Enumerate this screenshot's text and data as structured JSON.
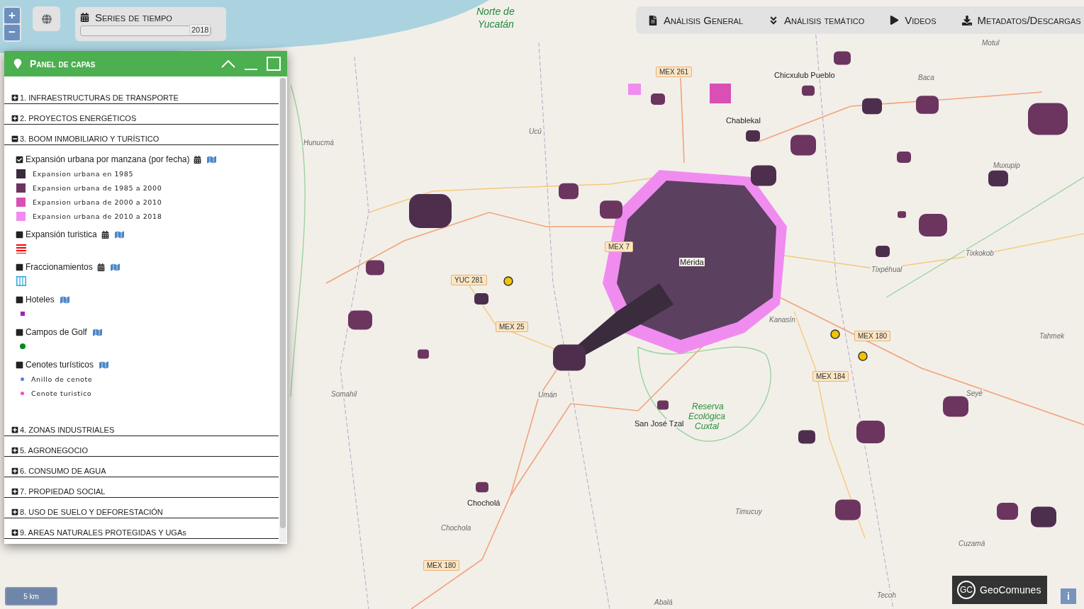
{
  "zoom": {
    "in": "+",
    "out": "−"
  },
  "time_series": {
    "title": "Series de tiempo",
    "reading": "2018",
    "level": 1
  },
  "nav": [
    {
      "label": "Análisis General",
      "kind": "file"
    },
    {
      "label": "Análisis temático",
      "kind": "double-down"
    },
    {
      "label": "Videos",
      "kind": "play"
    },
    {
      "label": "Metadatos/Descargas",
      "kind": "download"
    }
  ],
  "panel": {
    "title": "Panel de capas",
    "sections": [
      {
        "label": "1. INFRAESTRUCTURAS DE TRANSPORTE",
        "expanded": false
      },
      {
        "label": "2. PROYECTOS ENERGÉTICOS",
        "expanded": false
      },
      {
        "label": "3. BOOM INMOBILIARIO Y TURÍSTICO",
        "expanded": true,
        "layers": [
          {
            "label": "Expansión urbana por manzana (por fecha)",
            "checked": true,
            "calendar": true,
            "legend": [
              {
                "kind": "swatch",
                "color": "#3a2b3d",
                "label": "Expansion urbana en 1985"
              },
              {
                "kind": "swatch",
                "color": "#6b3560",
                "label": "Expansion urbana de 1985 a 2000"
              },
              {
                "kind": "swatch",
                "color": "#d94fb5",
                "label": "Expansion urbana de 2000 a 2010"
              },
              {
                "kind": "swatch",
                "color": "#f08cf0",
                "label": "Expansion urbana de 2010 a 2018"
              }
            ]
          },
          {
            "label": "Expansión turistica",
            "checked": false,
            "calendar": true,
            "legend": [
              {
                "kind": "hatch",
                "color": "#ff0000"
              }
            ]
          },
          {
            "label": "Fraccionamientos",
            "checked": false,
            "calendar": true,
            "legend": [
              {
                "kind": "grid",
                "color": "#29a9e0"
              }
            ]
          },
          {
            "label": "Hoteles",
            "checked": false,
            "calendar": false,
            "legend": [
              {
                "kind": "square",
                "color": "#a020c0"
              }
            ]
          },
          {
            "label": "Campos de Golf",
            "checked": false,
            "calendar": false,
            "legend": [
              {
                "kind": "dot",
                "color": "#008a20"
              }
            ]
          },
          {
            "label": "Cenotes turísticos",
            "checked": false,
            "calendar": false,
            "legend": [
              {
                "kind": "small-dot",
                "color": "#4a86e8",
                "label": "Anillo de cenote"
              },
              {
                "kind": "small-dot",
                "color": "#ff44cc",
                "label": "Cenote turistico"
              }
            ]
          }
        ]
      },
      {
        "label": "4. ZONAS INDUSTRIALES",
        "expanded": false
      },
      {
        "label": "5. AGRONEGOCIO",
        "expanded": false
      },
      {
        "label": "6. CONSUMO DE AGUA",
        "expanded": false
      },
      {
        "label": "7. PROPIEDAD SOCIAL",
        "expanded": false
      },
      {
        "label": "8. USO DE SUELO Y DEFORESTACIÓN",
        "expanded": false
      },
      {
        "label": "9. AREAS NATURALES PROTEGIDAS Y UGAs",
        "expanded": false
      }
    ]
  },
  "map": {
    "labels": [
      {
        "text": "Norte de",
        "kind": "water"
      },
      {
        "text": "Yucatán",
        "kind": "water"
      },
      {
        "text": "Motul",
        "kind": "village"
      },
      {
        "text": "MEX 261",
        "kind": "road"
      },
      {
        "text": "Chicxulub Pueblo",
        "kind": "town"
      },
      {
        "text": "Baca",
        "kind": "village"
      },
      {
        "text": "Chablekal",
        "kind": "town"
      },
      {
        "text": "Ucú",
        "kind": "village"
      },
      {
        "text": "Hunucmá",
        "kind": "village"
      },
      {
        "text": "Muxupip",
        "kind": "village"
      },
      {
        "text": "MEX 7",
        "kind": "road"
      },
      {
        "text": "Tixkokob",
        "kind": "village"
      },
      {
        "text": "Mérida",
        "kind": "town"
      },
      {
        "text": "Tixpéhual",
        "kind": "village"
      },
      {
        "text": "YUC 281",
        "kind": "road"
      },
      {
        "text": "MEX 25",
        "kind": "road"
      },
      {
        "text": "Kanasín",
        "kind": "village"
      },
      {
        "text": "MEX 180",
        "kind": "road"
      },
      {
        "text": "Tahmek",
        "kind": "village"
      },
      {
        "text": "MEX 184",
        "kind": "road"
      },
      {
        "text": "Somahil",
        "kind": "village"
      },
      {
        "text": "Umán",
        "kind": "village"
      },
      {
        "text": "Seyé",
        "kind": "village"
      },
      {
        "text": "Reserva",
        "kind": "reserve"
      },
      {
        "text": "San José Tzal",
        "kind": "town"
      },
      {
        "text": "Ecológica",
        "kind": "reserve"
      },
      {
        "text": "Cuxtal",
        "kind": "reserve"
      },
      {
        "text": "Chocholá",
        "kind": "town"
      },
      {
        "text": "Timucuy",
        "kind": "village"
      },
      {
        "text": "Chochola",
        "kind": "village"
      },
      {
        "text": "Cuzamá",
        "kind": "village"
      },
      {
        "text": "MEX 180",
        "kind": "road"
      },
      {
        "text": "Tecoh",
        "kind": "village"
      },
      {
        "text": "Abalá",
        "kind": "village"
      }
    ],
    "scale": "5 km"
  },
  "logo": {
    "mark": "GC",
    "name": "GeoComunes"
  },
  "info_button": "i"
}
